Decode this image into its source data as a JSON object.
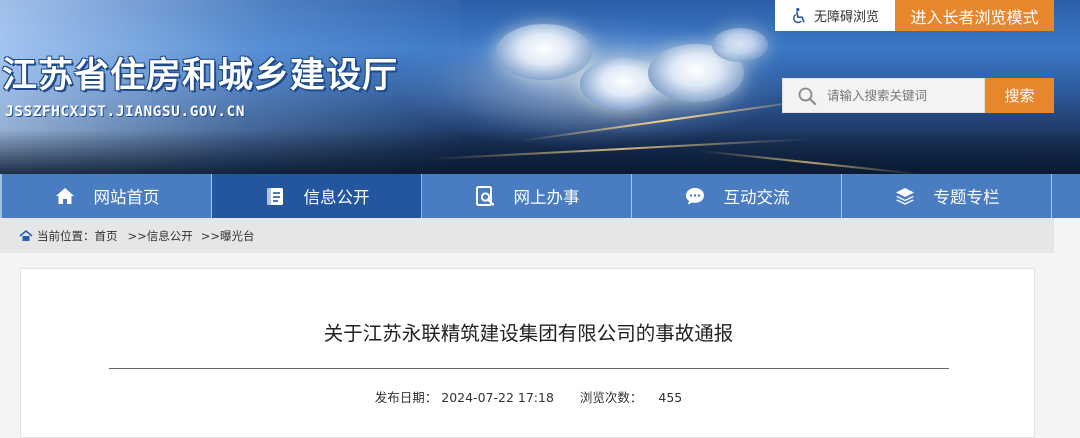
{
  "header": {
    "site_title": "江苏省住房和城乡建设厅",
    "site_domain": "JSSZFHCXJST.JIANGSU.GOV.CN",
    "accessibility_label": "无障碍浏览",
    "elder_mode_label": "进入长者浏览模式",
    "search": {
      "placeholder": "请输入搜索关键词",
      "button_label": "搜索"
    }
  },
  "nav": {
    "items": [
      {
        "label": "网站首页",
        "icon": "home-icon"
      },
      {
        "label": "信息公开",
        "icon": "document-icon",
        "active": true
      },
      {
        "label": "网上办事",
        "icon": "search-doc-icon"
      },
      {
        "label": "互动交流",
        "icon": "chat-icon"
      },
      {
        "label": "专题专栏",
        "icon": "layers-icon"
      }
    ]
  },
  "breadcrumb": {
    "prefix": "当前位置：",
    "items": [
      "首页",
      ">>信息公开",
      ">>曝光台"
    ]
  },
  "article": {
    "title": "关于江苏永联精筑建设集团有限公司的事故通报",
    "publish_label": "发布日期：",
    "publish_date": "2024-07-22 17:18",
    "views_label": "浏览次数：",
    "views": "455"
  },
  "colors": {
    "nav_bg": "#4a7cc1",
    "nav_active": "#24559f",
    "accent_orange": "#e8862c"
  }
}
